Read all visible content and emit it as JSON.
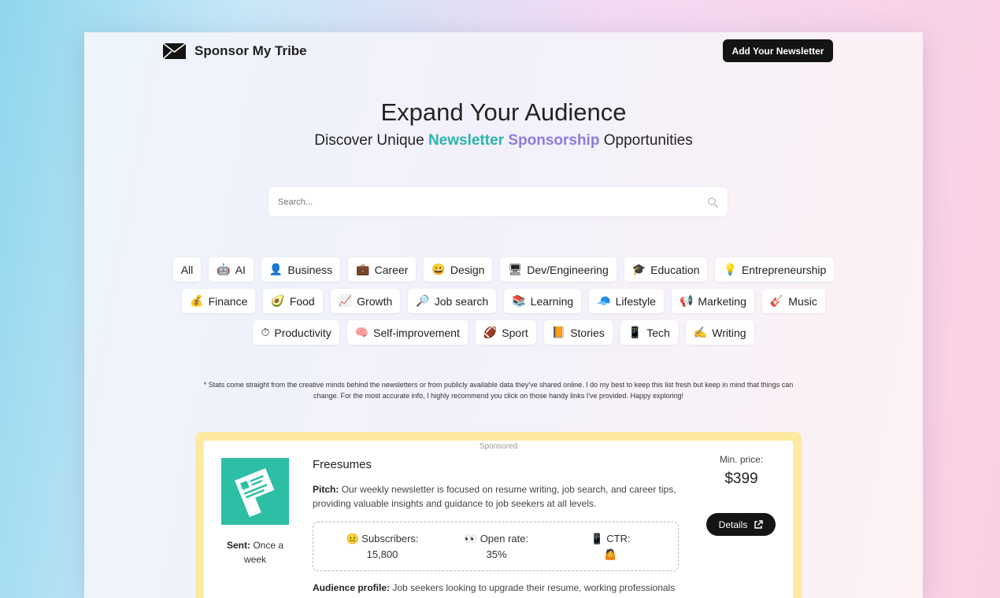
{
  "brand": {
    "name": "Sponsor My Tribe"
  },
  "header": {
    "add_button": "Add Your Newsletter"
  },
  "hero": {
    "title": "Expand Your Audience",
    "sub_prefix": "Discover Unique",
    "sub_hl1": "Newsletter",
    "sub_hl2": "Sponsorship",
    "sub_suffix": "Opportunities"
  },
  "search": {
    "placeholder": "Search..."
  },
  "categories": [
    [
      {
        "emoji": "",
        "label": "All"
      },
      {
        "emoji": "🤖",
        "label": "AI"
      },
      {
        "emoji": "👤",
        "label": "Business"
      },
      {
        "emoji": "💼",
        "label": "Career"
      },
      {
        "emoji": "😀",
        "label": "Design"
      },
      {
        "emoji": "🖥",
        "label": "Dev/Engineering"
      },
      {
        "emoji": "🎓",
        "label": "Education"
      },
      {
        "emoji": "💡",
        "label": "Entrepreneurship"
      }
    ],
    [
      {
        "emoji": "💰",
        "label": "Finance"
      },
      {
        "emoji": "🥑",
        "label": "Food"
      },
      {
        "emoji": "📈",
        "label": "Growth"
      },
      {
        "emoji": "🔎",
        "label": "Job search"
      },
      {
        "emoji": "📚",
        "label": "Learning"
      },
      {
        "emoji": "🧢",
        "label": "Lifestyle"
      },
      {
        "emoji": "📢",
        "label": "Marketing"
      },
      {
        "emoji": "🎸",
        "label": "Music"
      }
    ],
    [
      {
        "emoji": "⏱",
        "label": "Productivity"
      },
      {
        "emoji": "🧠",
        "label": "Self-improvement"
      },
      {
        "emoji": "🏈",
        "label": "Sport"
      },
      {
        "emoji": "📙",
        "label": "Stories"
      },
      {
        "emoji": "📱",
        "label": "Tech"
      },
      {
        "emoji": "✍",
        "label": "Writing"
      }
    ]
  ],
  "note": "* Stats come straight from the creative minds behind the newsletters or from publicly available data they've shared online. I do my best to keep this list fresh but keep in mind that things can change. For the most accurate info, I highly recommend you click on those handy links I've provided. Happy exploring!",
  "listing": {
    "badge": "Sponsored",
    "name": "Freesumes",
    "pitch_label": "Pitch:",
    "pitch": "Our weekly newsletter is focused on resume writing, job search, and career tips, providing valuable insights and guidance to job seekers at all levels.",
    "sent_label": "Sent:",
    "sent": "Once a week",
    "subscribers_label": "Subscribers:",
    "subscribers": "15,800",
    "open_rate_label": "Open rate:",
    "open_rate": "35%",
    "ctr_label": "CTR:",
    "ctr": "🤷",
    "audience_label": "Audience profile:",
    "audience": "Job seekers looking to upgrade their resume, working professionals",
    "min_price_label": "Min. price:",
    "min_price": "$399",
    "details_button": "Details"
  },
  "colors": {
    "accent_teal": "#2bb3b1",
    "accent_purple": "#8c7be0",
    "sponsored_border": "#fde9a0",
    "thumb_bg": "#2cbfa5"
  }
}
